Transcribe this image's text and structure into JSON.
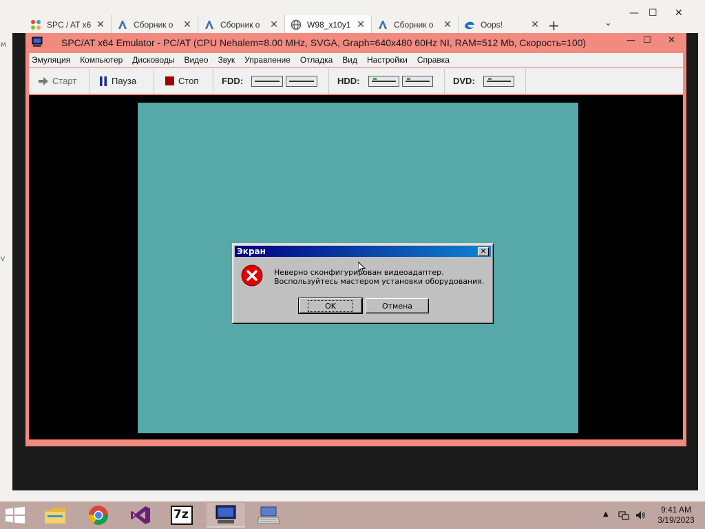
{
  "desktop": {
    "edge_glyphs": [
      "M",
      "V"
    ]
  },
  "browser": {
    "tabs": [
      {
        "title": "SPC / AT x6",
        "icon": "joomla-icon",
        "active": false
      },
      {
        "title": "Сборник о",
        "icon": "document-icon",
        "active": false
      },
      {
        "title": "Сборник о",
        "icon": "document-icon",
        "active": false
      },
      {
        "title": "W98_x10y1",
        "icon": "globe-icon",
        "active": true
      },
      {
        "title": "Сборник о",
        "icon": "document-icon",
        "active": false
      },
      {
        "title": "Oops!",
        "icon": "edge-icon",
        "active": false
      }
    ],
    "tab_close_glyph": "✕",
    "new_tab_glyph": "+",
    "tab_menu_glyph": "⌄",
    "window_controls": {
      "minimize": "—",
      "maximize": "☐",
      "close": "✕"
    }
  },
  "emulator": {
    "title": "SPC/AT x64 Emulator - PC/AT (CPU Nehalem=8.00 MHz, SVGA, Graph=640x480 60Hz NI, RAM=512 Mb, Скорость=100)",
    "window_controls": {
      "minimize": "—",
      "maximize": "☐",
      "close": "✕"
    },
    "menu": [
      "Эмуляция",
      "Компьютер",
      "Дисководы",
      "Видео",
      "Звук",
      "Управление",
      "Отладка",
      "Вид",
      "Настройки",
      "Справка"
    ],
    "toolbar": {
      "start": "Старт",
      "pause": "Пауза",
      "stop": "Стоп",
      "fdd_label": "FDD:",
      "hdd_label": "HDD:",
      "dvd_label": "DVD:"
    },
    "colors": {
      "frame": "#f28a80",
      "guest_desktop": "#57a8a8"
    }
  },
  "dialog": {
    "title": "Экран",
    "close_glyph": "✕",
    "icon": "error-icon",
    "message": "Неверно сконфигурирован видеоадаптер.  Воспользуйтесь мастером установки оборудования.",
    "ok_label": "OK",
    "cancel_label": "Отмена"
  },
  "taskbar": {
    "apps": [
      "file-explorer-icon",
      "chrome-icon",
      "visual-studio-icon",
      "7zip-icon",
      "emulator-icon",
      "keyboard-icon"
    ],
    "sevenzip_text": "7z",
    "tray_arrow": "▲",
    "time": "9:41 AM",
    "date": "3/19/2023"
  }
}
